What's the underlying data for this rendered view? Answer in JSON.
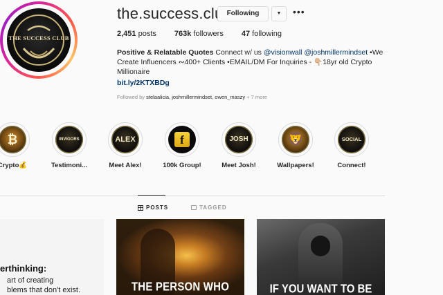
{
  "profile": {
    "username": "the.success.club",
    "avatar_text": "THE SUCCESS CLUB",
    "following_button": "Following",
    "dropdown_glyph": "▼",
    "more_glyph": "•••",
    "stats": {
      "posts_count": "2,451",
      "posts_label": " posts",
      "followers_count": "763k",
      "followers_label": " followers",
      "following_count": "47",
      "following_label": " following"
    },
    "bio": {
      "name": "Positive & Relatable Quotes",
      "text_1": " Connect w/ us ",
      "mention_1": "@visionwall",
      "text_2": " ",
      "mention_2": "@joshmillermindset",
      "text_3": " •We Create Influencers ∾400+ Clients •EMAIL/DM For Inquiries - 👇🏼18yr old Crypto Millionaire",
      "link": "bit.ly/2KTXBDg"
    },
    "followed_by_prefix": "Followed by ",
    "followed_by_names": "stelaalicia, joshmillermindset, owen_maszy",
    "followed_by_more": " + 7 more"
  },
  "highlights": [
    {
      "label": "Crypto💰",
      "icon_text": "₿",
      "icon": "bitcoin-icon"
    },
    {
      "label": "Testimoni...",
      "icon_text": "INVIGORS",
      "icon": "invigors-logo-icon"
    },
    {
      "label": "Meet Alex!",
      "icon_text": "ALEX",
      "icon": "alex-logo-icon"
    },
    {
      "label": "100k Group!",
      "icon_text": "f",
      "icon": "facebook-icon"
    },
    {
      "label": "Meet Josh!",
      "icon_text": "JOSH",
      "icon": "josh-logo-icon"
    },
    {
      "label": "Wallpapers!",
      "icon_text": "🦁",
      "icon": "lion-icon"
    },
    {
      "label": "Connect!",
      "icon_text": "SOCIAL",
      "icon": "social-logo-icon"
    }
  ],
  "tabs": {
    "posts": "POSTS",
    "tagged": "TAGGED"
  },
  "posts": [
    {
      "title": "erthinking:",
      "body": "art of creating\nblems that don't exist."
    },
    {
      "caption": "THE PERSON WHO"
    },
    {
      "caption": "IF YOU WANT TO BE"
    }
  ],
  "colors": {
    "link": "#003569",
    "muted": "#8e8e8e",
    "border": "#dbdbdb",
    "text": "#262626"
  }
}
